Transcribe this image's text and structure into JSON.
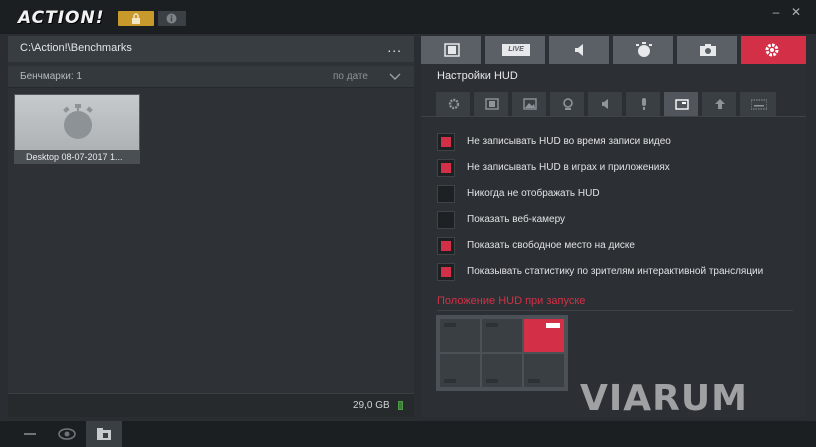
{
  "app": {
    "logo_text": "ACTION!",
    "path": "C:\\Action!\\Benchmarks",
    "path_menu": "..."
  },
  "window_controls": {
    "minimize": "–",
    "close": "✕"
  },
  "left_panel": {
    "list_count": "Бенчмарки: 1",
    "sort_label": "по дате",
    "items": [
      {
        "caption": "Desktop 08-07-2017 1...",
        "icon": "stopwatch-icon"
      }
    ],
    "free_space": "29,0 GB"
  },
  "top_tabs": [
    {
      "icon": "film-icon",
      "active": false
    },
    {
      "icon": "live-icon",
      "label": "LIVE",
      "active": false
    },
    {
      "icon": "speaker-icon",
      "active": false
    },
    {
      "icon": "stopwatch-icon",
      "active": false
    },
    {
      "icon": "camera-icon",
      "active": false
    },
    {
      "icon": "gear-icon",
      "active": true
    }
  ],
  "settings": {
    "section_title": "Настройки HUD",
    "sub_tabs": [
      {
        "icon": "gear-icon",
        "active": false
      },
      {
        "icon": "film-icon",
        "active": false
      },
      {
        "icon": "image-icon",
        "active": false
      },
      {
        "icon": "webcam-icon",
        "active": false
      },
      {
        "icon": "speaker-icon",
        "active": false
      },
      {
        "icon": "microphone-icon",
        "active": false
      },
      {
        "icon": "hud-icon",
        "active": true
      },
      {
        "icon": "upload-icon",
        "active": false
      },
      {
        "icon": "keyboard-icon",
        "active": false
      }
    ],
    "options": [
      {
        "label": "Не записывать HUD во время записи видео",
        "checked": true
      },
      {
        "label": "Не записывать HUD в играх и приложениях",
        "checked": true
      },
      {
        "label": "Никогда не отображать HUD",
        "checked": false
      },
      {
        "label": "Показать веб-камеру",
        "checked": false
      },
      {
        "label": "Показать свободное место на диске",
        "checked": true
      },
      {
        "label": "Показывать статистику по зрителям интерактивной трансляции",
        "checked": true
      }
    ],
    "position_title": "Положение HUD при запуске",
    "position_selected": "top-right"
  },
  "watermark": "VIARUM",
  "bottom_bar": [
    {
      "icon": "minus-icon",
      "active": false
    },
    {
      "icon": "eye-icon",
      "active": false
    },
    {
      "icon": "folder-icon",
      "active": true
    }
  ],
  "colors": {
    "accent": "#d33047",
    "lock": "#c89a2c",
    "background": "#2a2e32"
  }
}
